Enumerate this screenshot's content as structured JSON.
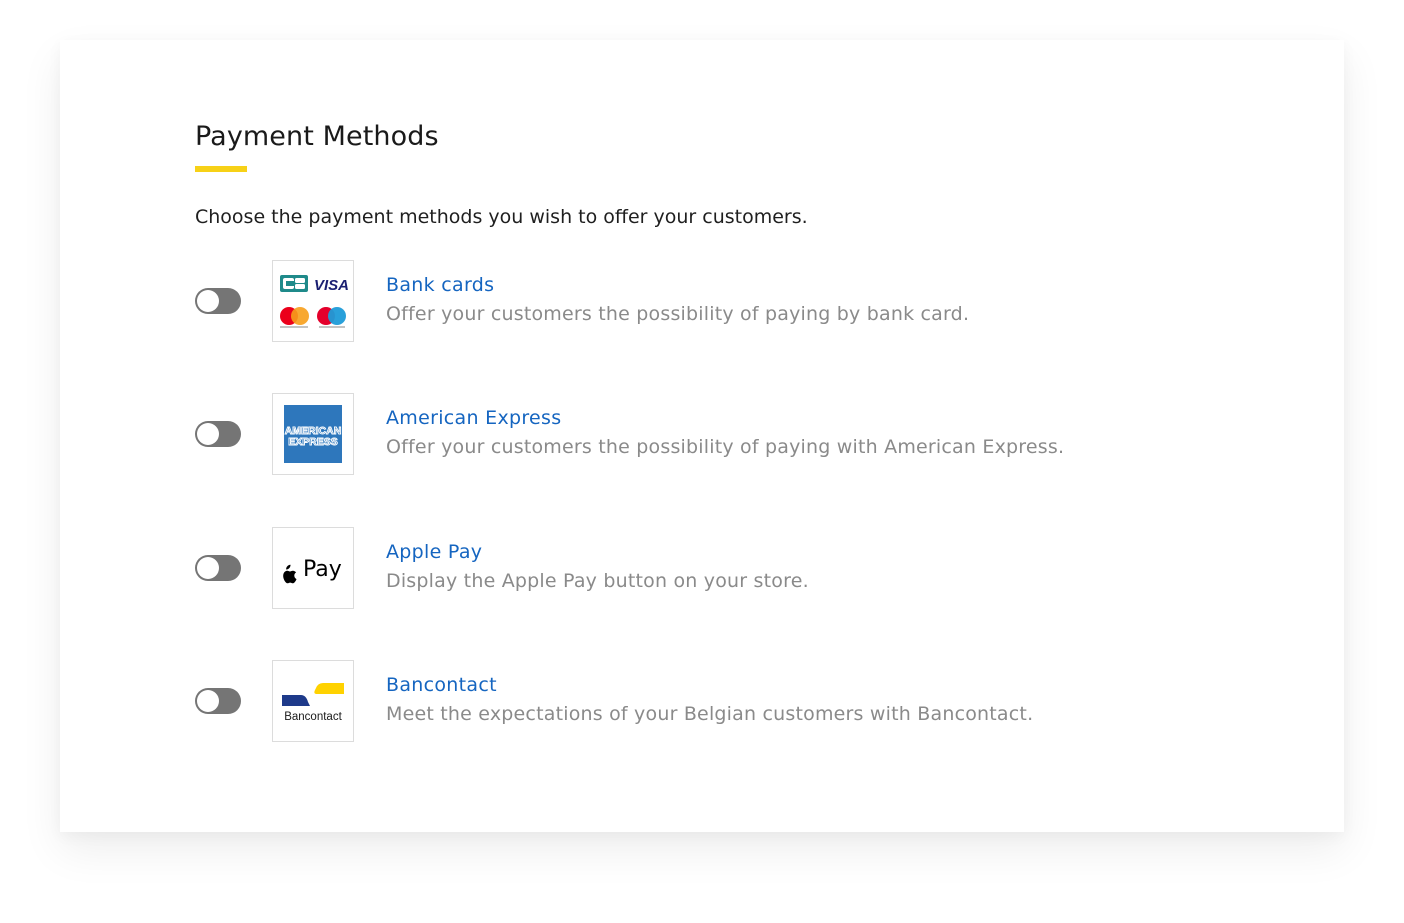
{
  "page": {
    "title": "Payment Methods",
    "intro": "Choose the payment methods you wish to offer your customers."
  },
  "colors": {
    "accent_underline": "#f7d117",
    "method_name": "#1565c0",
    "description": "#8a8a8a",
    "toggle_off": "#757575"
  },
  "methods": [
    {
      "name": "Bank cards",
      "description": "Offer your customers the possibility of paying by bank card.",
      "enabled": false,
      "logo": "cb-visa-mastercard-maestro-logo",
      "logo_text": [
        "VISA"
      ]
    },
    {
      "name": "American Express",
      "description": "Offer your customers the possibility of paying with American Express.",
      "enabled": false,
      "logo": "american-express-logo",
      "logo_text": [
        "AMERICAN",
        "EXPRESS"
      ]
    },
    {
      "name": "Apple Pay",
      "description": "Display the Apple Pay button on your store.",
      "enabled": false,
      "logo": "apple-pay-logo",
      "logo_text": [
        "Pay"
      ]
    },
    {
      "name": "Bancontact",
      "description": "Meet the expectations of your Belgian customers with Bancontact.",
      "enabled": false,
      "logo": "bancontact-logo",
      "logo_text": [
        "Bancontact"
      ]
    }
  ]
}
